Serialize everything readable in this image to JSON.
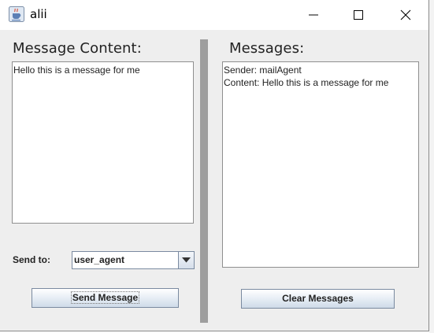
{
  "window": {
    "title": "alii",
    "icon": "java-cup-icon"
  },
  "titlebar_buttons": {
    "minimize": "minimize-icon",
    "maximize": "maximize-icon",
    "close": "close-icon"
  },
  "left_panel": {
    "heading": "Message Content:",
    "message_text": "Hello this is a message for me",
    "send_to_label": "Send to:",
    "recipient_selected": "user_agent",
    "send_button": "Send Message"
  },
  "right_panel": {
    "heading": "Messages:",
    "messages": [
      "Sender: mailAgent",
      "Content: Hello this is a message for me"
    ],
    "clear_button": "Clear Messages"
  },
  "colors": {
    "window_bg": "#eeeeee",
    "divider": "#9e9e9e",
    "desktop_green": "#1e7145"
  }
}
